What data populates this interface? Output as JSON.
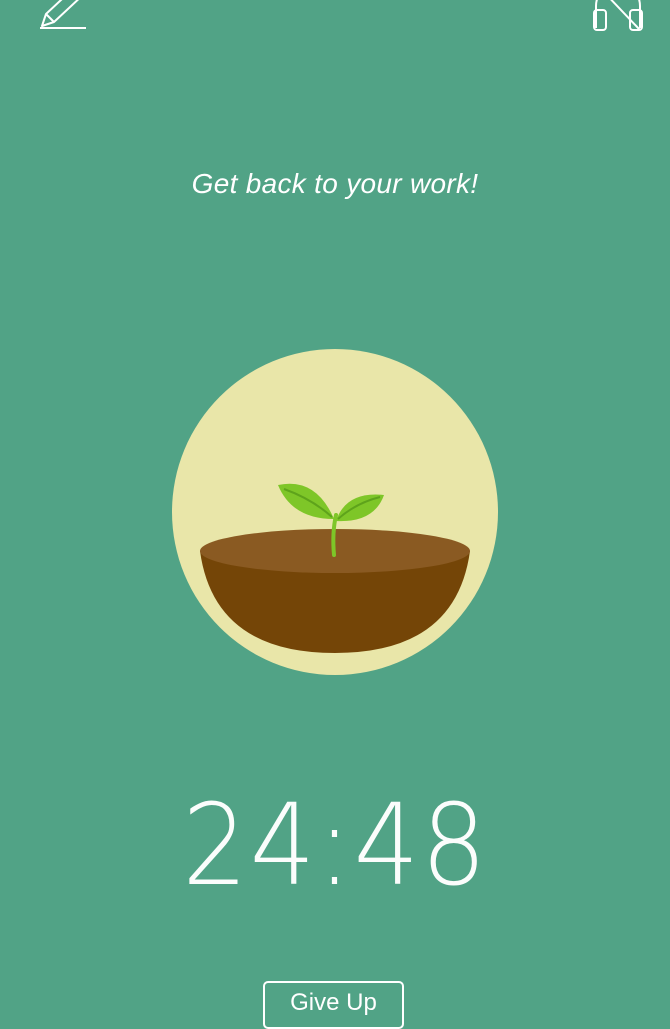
{
  "header": {
    "edit_icon": "pencil-edit-icon",
    "sound_icon": "sound-muted-icon"
  },
  "message": "Get back to your work!",
  "plant": {
    "icon": "seedling-in-pot-icon",
    "colors": {
      "circle": "#e9e6a9",
      "soil_top": "#8a5a22",
      "soil_bowl": "#744507",
      "leaf": "#7ec628",
      "leaf_dark": "#5ea31b"
    }
  },
  "timer": {
    "text": "24:48"
  },
  "actions": {
    "give_up_label": "Give Up"
  },
  "theme": {
    "background": "#51a386",
    "foreground": "#ffffff"
  }
}
